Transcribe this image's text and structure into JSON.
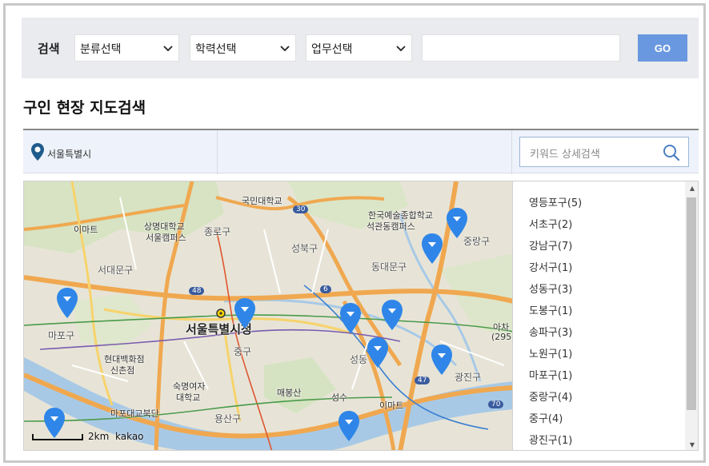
{
  "search": {
    "label": "검색",
    "category_select": "분류선택",
    "education_select": "학력선택",
    "job_select": "업무선택",
    "keyword_value": "",
    "go_label": "GO"
  },
  "page": {
    "title": "구인 현장 지도검색"
  },
  "region": {
    "name": "서울특별시",
    "detail_placeholder": "키워드 상세검색"
  },
  "map": {
    "labels": {
      "emart1": "이마트",
      "sangmyung": "상명대학교",
      "sangmyung2": "서울캠퍼스",
      "jongno": "종로구",
      "kookmin": "국민대학교",
      "knua": "한국예술종합학교",
      "knua2": "석관동캠퍼스",
      "jungnang": "중랑구",
      "seodaemun": "서대문구",
      "seongbuk": "성북구",
      "dongdaemun": "동대문구",
      "cityhall": "서울특별시청",
      "mapo": "마포구",
      "junggu": "중구",
      "hyundai": "현대백화점",
      "hyundai2": "신촌점",
      "sookmyung": "숙명여자",
      "sookmyung2": "대학교",
      "seongdong": "성동",
      "gwangjin": "광진구",
      "maebong": "매봉산",
      "seongsu": "성수",
      "emart2": "이마트",
      "mapogyo": "마포대교북단",
      "yongsan": "용산구",
      "acha": "아차",
      "acha2": "(295.7"
    },
    "shields": {
      "r30": "30",
      "r48": "48",
      "r6": "6",
      "r47": "47",
      "r70": "70"
    },
    "scale_text": "2km",
    "provider": "kakao",
    "marker_color": "#2f86e8"
  },
  "districts": [
    "영등포구(5)",
    "서초구(2)",
    "강남구(7)",
    "강서구(1)",
    "성동구(3)",
    "도봉구(1)",
    "송파구(3)",
    "노원구(1)",
    "마포구(1)",
    "중랑구(4)",
    "중구(4)",
    "광진구(1)"
  ]
}
